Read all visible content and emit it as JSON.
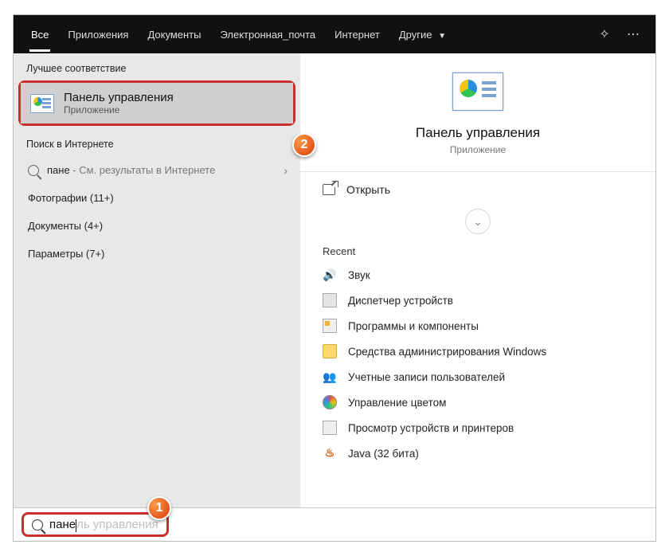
{
  "tabs": {
    "all": "Все",
    "apps": "Приложения",
    "docs": "Документы",
    "email": "Электронная_почта",
    "internet": "Интернет",
    "more": "Другие"
  },
  "left": {
    "bestHeader": "Лучшее соответствие",
    "best": {
      "title": "Панель управления",
      "sub": "Приложение"
    },
    "webHeader": "Поиск в Интернете",
    "webQuery": "пане",
    "webSuffix": " - См. результаты в Интернете",
    "cats": {
      "photos": "Фотографии (11+)",
      "docs": "Документы (4+)",
      "params": "Параметры (7+)"
    }
  },
  "right": {
    "title": "Панель управления",
    "sub": "Приложение",
    "open": "Открыть",
    "recentHeader": "Recent",
    "recent": [
      "Звук",
      "Диспетчер устройств",
      "Программы и компоненты",
      "Средства администрирования Windows",
      "Учетные записи пользователей",
      "Управление цветом",
      "Просмотр устройств и принтеров",
      "Java (32 бита)"
    ]
  },
  "search": {
    "typed": "пане",
    "ghost": "ль управления"
  },
  "annotations": {
    "one": "1",
    "two": "2"
  }
}
